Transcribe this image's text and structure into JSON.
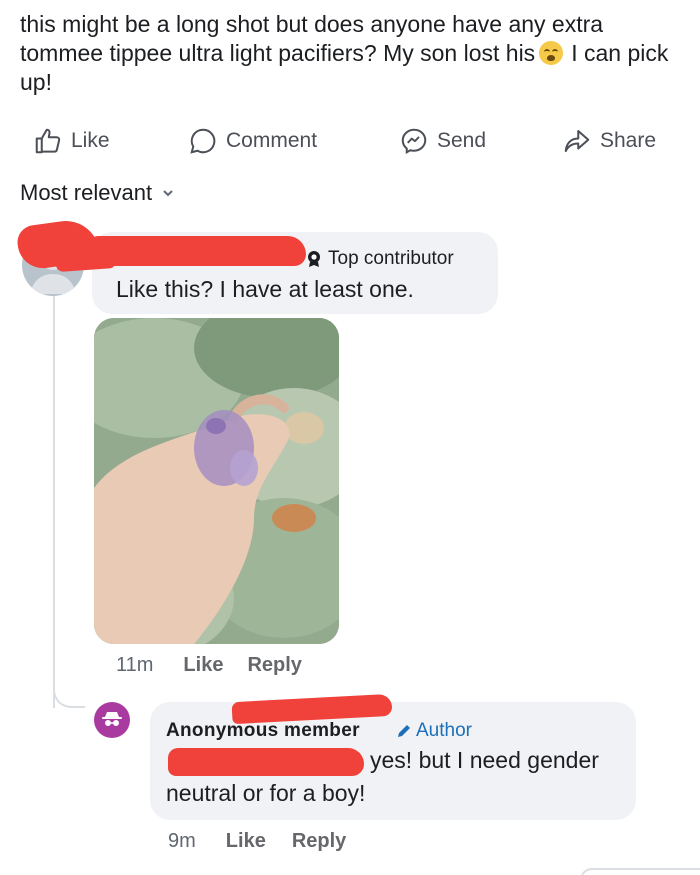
{
  "post": {
    "text_before_emoji": "this might be a long shot but does anyone have any extra tommee tippee ultra light pacifiers? My son lost his",
    "text_after_emoji": "I can pick up!",
    "emoji_icon": "crying-face-emoji"
  },
  "actions": {
    "like": "Like",
    "comment": "Comment",
    "send": "Send",
    "share": "Share"
  },
  "sort": {
    "label": "Most relevant",
    "icon": "chevron-down-icon"
  },
  "comments": [
    {
      "badge": "Top contributor",
      "text": "Like this? I have at least one.",
      "has_photo": true,
      "time": "11m",
      "like": "Like",
      "reply": "Reply"
    },
    {
      "author_name": "Anonymous member",
      "author_badge": "Author",
      "text_line1": "yes! but I need gender",
      "text_line2": "neutral or for a boy!",
      "time": "9m",
      "like": "Like",
      "reply": "Reply"
    }
  ],
  "colors": {
    "redaction": "#f0413a",
    "author_badge": "#1c6fb8",
    "anonymous_avatar": "#a83aa0",
    "bubble": "#f0f2f5"
  }
}
